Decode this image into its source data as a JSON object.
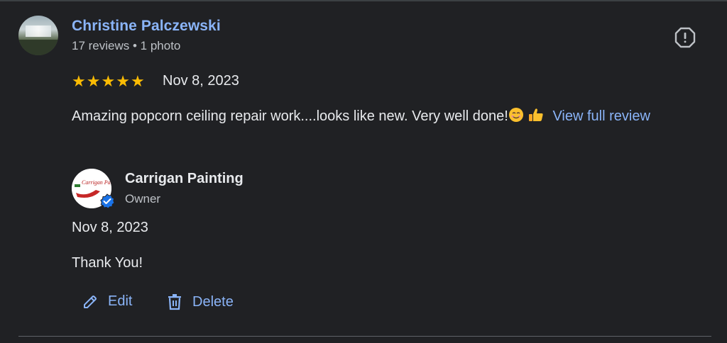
{
  "review": {
    "reviewer_name": "Christine Palczewski",
    "reviewer_meta": "17 reviews • 1 photo",
    "rating": 5,
    "date": "Nov 8, 2023",
    "text": "Amazing popcorn ceiling repair work....looks like new. Very well done!",
    "emojis": [
      "smiling-face",
      "thumbs-up"
    ],
    "view_full_label": "View full review"
  },
  "owner_reply": {
    "owner_name": "Carrigan Painting",
    "logo_text": "Carrigan Painting",
    "owner_role": "Owner",
    "date": "Nov 8, 2023",
    "text": "Thank You!"
  },
  "actions": {
    "edit_label": "Edit",
    "delete_label": "Delete"
  },
  "icons": {
    "report": "report-icon",
    "star": "star-icon",
    "edit": "pencil-icon",
    "delete": "trash-icon",
    "verified": "verified-badge-icon"
  },
  "colors": {
    "background": "#202124",
    "link": "#8ab4f8",
    "star": "#fbbc04",
    "verified": "#1a73e8"
  }
}
